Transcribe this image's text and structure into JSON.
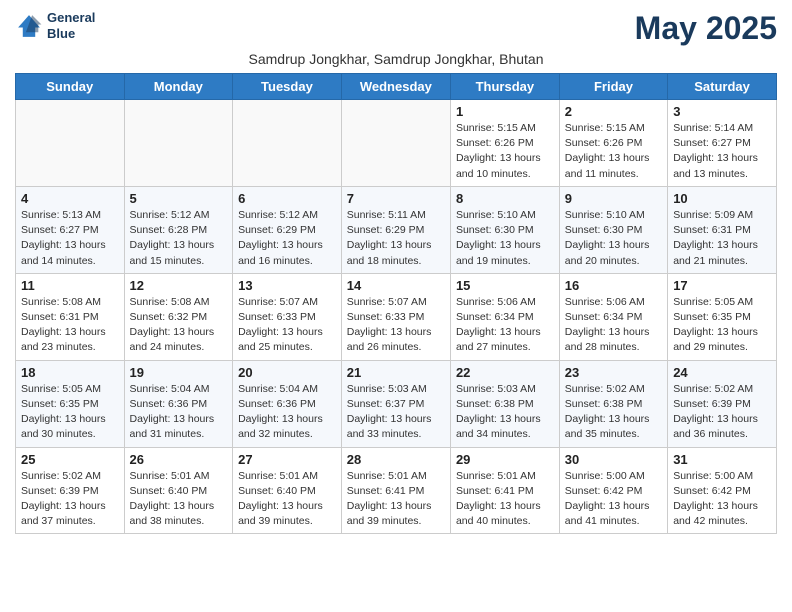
{
  "header": {
    "logo_line1": "General",
    "logo_line2": "Blue",
    "month": "May 2025",
    "subtitle": "Samdrup Jongkhar, Samdrup Jongkhar, Bhutan"
  },
  "weekdays": [
    "Sunday",
    "Monday",
    "Tuesday",
    "Wednesday",
    "Thursday",
    "Friday",
    "Saturday"
  ],
  "weeks": [
    [
      {
        "day": "",
        "info": ""
      },
      {
        "day": "",
        "info": ""
      },
      {
        "day": "",
        "info": ""
      },
      {
        "day": "",
        "info": ""
      },
      {
        "day": "1",
        "info": "Sunrise: 5:15 AM\nSunset: 6:26 PM\nDaylight: 13 hours\nand 10 minutes."
      },
      {
        "day": "2",
        "info": "Sunrise: 5:15 AM\nSunset: 6:26 PM\nDaylight: 13 hours\nand 11 minutes."
      },
      {
        "day": "3",
        "info": "Sunrise: 5:14 AM\nSunset: 6:27 PM\nDaylight: 13 hours\nand 13 minutes."
      }
    ],
    [
      {
        "day": "4",
        "info": "Sunrise: 5:13 AM\nSunset: 6:27 PM\nDaylight: 13 hours\nand 14 minutes."
      },
      {
        "day": "5",
        "info": "Sunrise: 5:12 AM\nSunset: 6:28 PM\nDaylight: 13 hours\nand 15 minutes."
      },
      {
        "day": "6",
        "info": "Sunrise: 5:12 AM\nSunset: 6:29 PM\nDaylight: 13 hours\nand 16 minutes."
      },
      {
        "day": "7",
        "info": "Sunrise: 5:11 AM\nSunset: 6:29 PM\nDaylight: 13 hours\nand 18 minutes."
      },
      {
        "day": "8",
        "info": "Sunrise: 5:10 AM\nSunset: 6:30 PM\nDaylight: 13 hours\nand 19 minutes."
      },
      {
        "day": "9",
        "info": "Sunrise: 5:10 AM\nSunset: 6:30 PM\nDaylight: 13 hours\nand 20 minutes."
      },
      {
        "day": "10",
        "info": "Sunrise: 5:09 AM\nSunset: 6:31 PM\nDaylight: 13 hours\nand 21 minutes."
      }
    ],
    [
      {
        "day": "11",
        "info": "Sunrise: 5:08 AM\nSunset: 6:31 PM\nDaylight: 13 hours\nand 23 minutes."
      },
      {
        "day": "12",
        "info": "Sunrise: 5:08 AM\nSunset: 6:32 PM\nDaylight: 13 hours\nand 24 minutes."
      },
      {
        "day": "13",
        "info": "Sunrise: 5:07 AM\nSunset: 6:33 PM\nDaylight: 13 hours\nand 25 minutes."
      },
      {
        "day": "14",
        "info": "Sunrise: 5:07 AM\nSunset: 6:33 PM\nDaylight: 13 hours\nand 26 minutes."
      },
      {
        "day": "15",
        "info": "Sunrise: 5:06 AM\nSunset: 6:34 PM\nDaylight: 13 hours\nand 27 minutes."
      },
      {
        "day": "16",
        "info": "Sunrise: 5:06 AM\nSunset: 6:34 PM\nDaylight: 13 hours\nand 28 minutes."
      },
      {
        "day": "17",
        "info": "Sunrise: 5:05 AM\nSunset: 6:35 PM\nDaylight: 13 hours\nand 29 minutes."
      }
    ],
    [
      {
        "day": "18",
        "info": "Sunrise: 5:05 AM\nSunset: 6:35 PM\nDaylight: 13 hours\nand 30 minutes."
      },
      {
        "day": "19",
        "info": "Sunrise: 5:04 AM\nSunset: 6:36 PM\nDaylight: 13 hours\nand 31 minutes."
      },
      {
        "day": "20",
        "info": "Sunrise: 5:04 AM\nSunset: 6:36 PM\nDaylight: 13 hours\nand 32 minutes."
      },
      {
        "day": "21",
        "info": "Sunrise: 5:03 AM\nSunset: 6:37 PM\nDaylight: 13 hours\nand 33 minutes."
      },
      {
        "day": "22",
        "info": "Sunrise: 5:03 AM\nSunset: 6:38 PM\nDaylight: 13 hours\nand 34 minutes."
      },
      {
        "day": "23",
        "info": "Sunrise: 5:02 AM\nSunset: 6:38 PM\nDaylight: 13 hours\nand 35 minutes."
      },
      {
        "day": "24",
        "info": "Sunrise: 5:02 AM\nSunset: 6:39 PM\nDaylight: 13 hours\nand 36 minutes."
      }
    ],
    [
      {
        "day": "25",
        "info": "Sunrise: 5:02 AM\nSunset: 6:39 PM\nDaylight: 13 hours\nand 37 minutes."
      },
      {
        "day": "26",
        "info": "Sunrise: 5:01 AM\nSunset: 6:40 PM\nDaylight: 13 hours\nand 38 minutes."
      },
      {
        "day": "27",
        "info": "Sunrise: 5:01 AM\nSunset: 6:40 PM\nDaylight: 13 hours\nand 39 minutes."
      },
      {
        "day": "28",
        "info": "Sunrise: 5:01 AM\nSunset: 6:41 PM\nDaylight: 13 hours\nand 39 minutes."
      },
      {
        "day": "29",
        "info": "Sunrise: 5:01 AM\nSunset: 6:41 PM\nDaylight: 13 hours\nand 40 minutes."
      },
      {
        "day": "30",
        "info": "Sunrise: 5:00 AM\nSunset: 6:42 PM\nDaylight: 13 hours\nand 41 minutes."
      },
      {
        "day": "31",
        "info": "Sunrise: 5:00 AM\nSunset: 6:42 PM\nDaylight: 13 hours\nand 42 minutes."
      }
    ]
  ]
}
